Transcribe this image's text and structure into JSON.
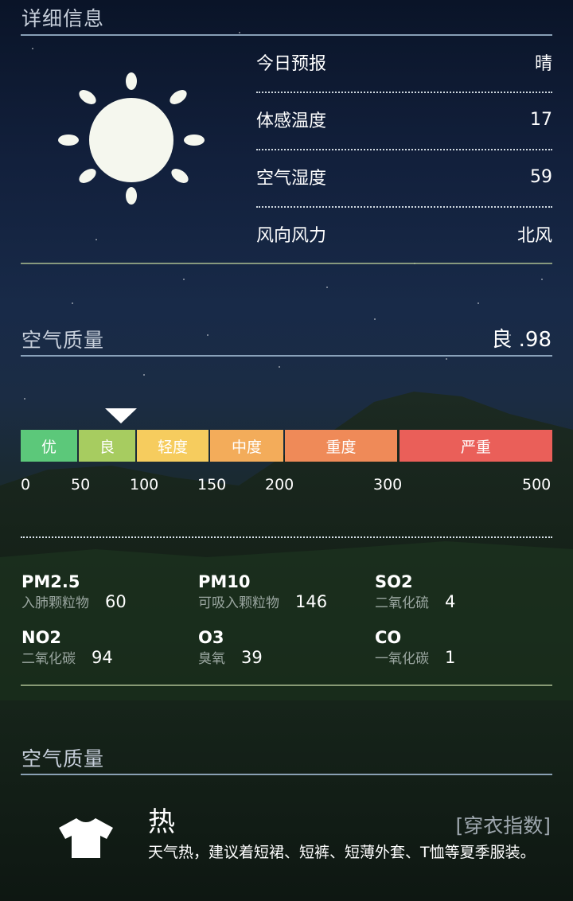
{
  "details": {
    "title": "详细信息",
    "rows": [
      {
        "label": "今日预报",
        "value": "晴"
      },
      {
        "label": "体感温度",
        "value": "17"
      },
      {
        "label": "空气湿度",
        "value": "59"
      },
      {
        "label": "风向风力",
        "value": "北风"
      }
    ]
  },
  "air_quality": {
    "title": "空气质量",
    "level": "良",
    "value": ".98",
    "scale": [
      {
        "label": "优",
        "color": "#5cc87a"
      },
      {
        "label": "良",
        "color": "#a7cc60"
      },
      {
        "label": "轻度",
        "color": "#f6cc5e"
      },
      {
        "label": "中度",
        "color": "#f3ac5a"
      },
      {
        "label": "重度",
        "color": "#ef8a58"
      },
      {
        "label": "严重",
        "color": "#ea5f59"
      }
    ],
    "ticks": [
      "0",
      "50",
      "100",
      "150",
      "200",
      "300",
      "500"
    ],
    "pollutants": [
      {
        "name": "PM2.5",
        "cn": "入肺颗粒物",
        "value": "60"
      },
      {
        "name": "PM10",
        "cn": "可吸入颗粒物",
        "value": "146"
      },
      {
        "name": "SO2",
        "cn": "二氧化硫",
        "value": "4"
      },
      {
        "name": "NO2",
        "cn": "二氧化碳",
        "value": "94"
      },
      {
        "name": "O3",
        "cn": "臭氧",
        "value": "39"
      },
      {
        "name": "CO",
        "cn": "一氧化碳",
        "value": "1"
      }
    ]
  },
  "index": {
    "title": "空气质量",
    "level": "热",
    "category": "[穿衣指数]",
    "description": "天气热，建议着短裙、短裤、短薄外套、T恤等夏季服装。",
    "icon": "tshirt-icon"
  },
  "weather_icon": "sun-icon"
}
